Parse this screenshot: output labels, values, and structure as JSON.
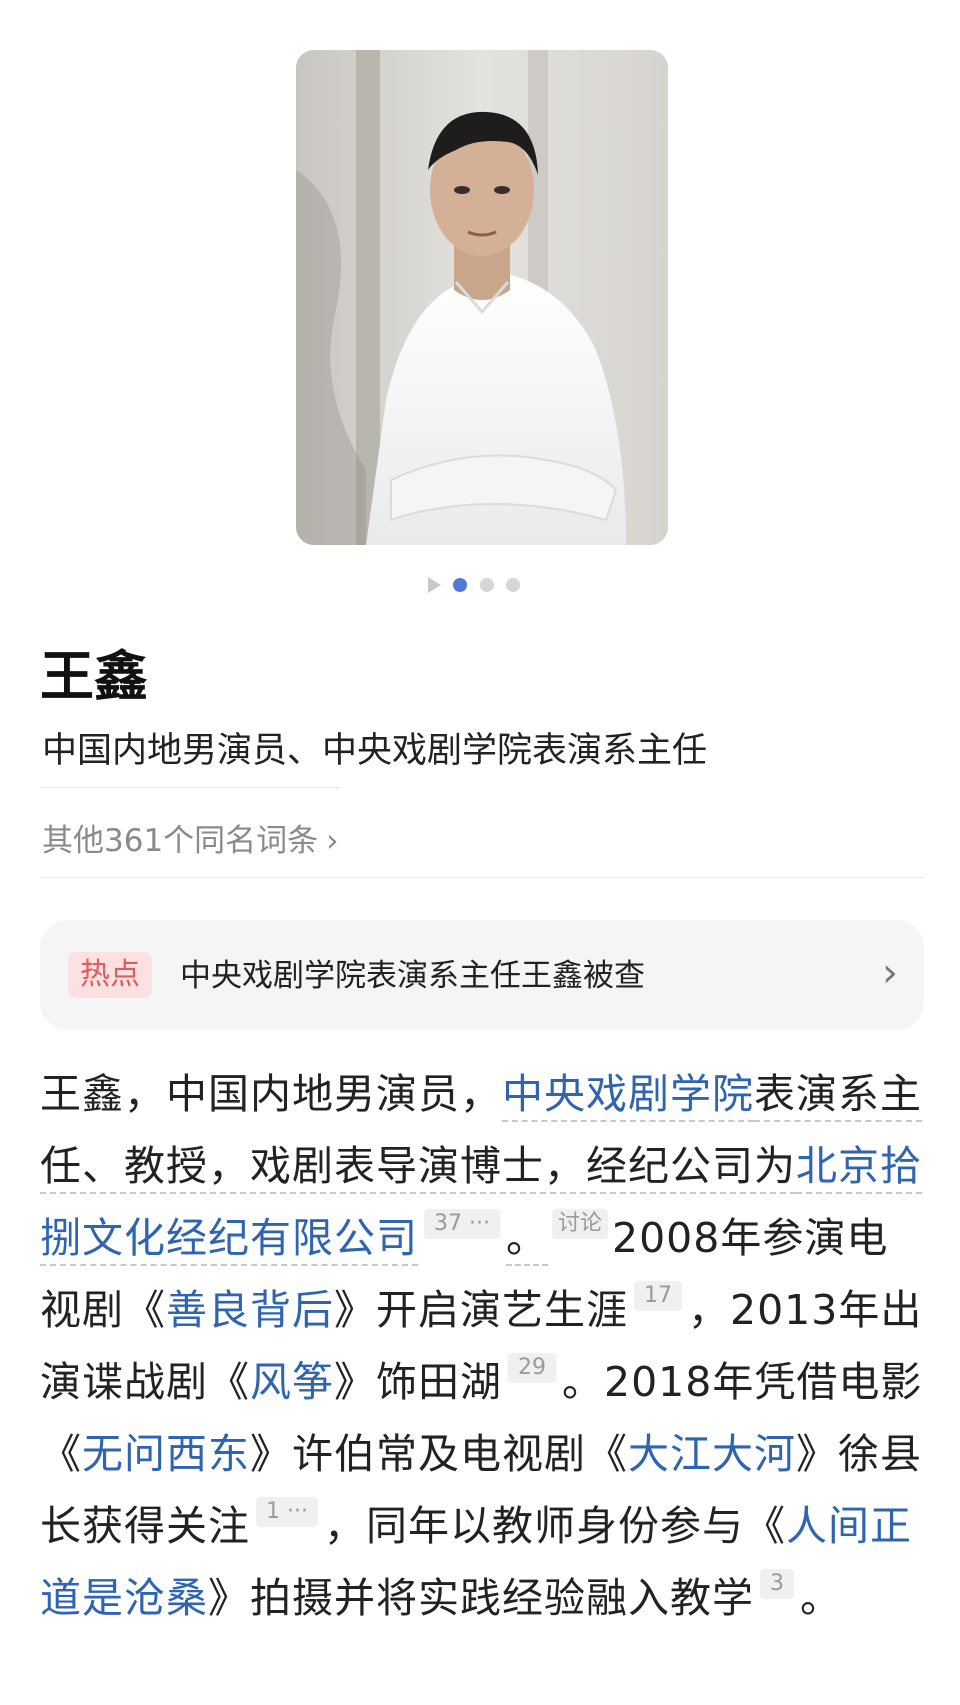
{
  "gallery": {
    "photo_alt": "王鑫",
    "dot_count": 3,
    "active_dot": 0
  },
  "entry": {
    "title": "王鑫",
    "subtitle": "中国内地男演员、中央戏剧学院表演系主任",
    "other_entries": "其他361个同名词条",
    "other_chevron": "›"
  },
  "hot": {
    "badge": "热点",
    "text": "中央戏剧学院表演系主任王鑫被查",
    "chevron": "›"
  },
  "body": {
    "p1": "王鑫，中国内地男演员，",
    "l1": "中央戏剧学院",
    "p2": "表演系主任、教授，戏剧表导演博士，经纪公司为",
    "l2": "北京拾捌文化经纪有限公司",
    "r1": "37 ···",
    "p3": "。",
    "disc": "讨论",
    "p4": "2008年参演电视剧《",
    "l3": "善良背后",
    "p5": "》开启演艺生涯",
    "r2": "17",
    "p6": "，2013年出演谍战剧《",
    "l4": "风筝",
    "p7": "》饰田湖",
    "r3": "29",
    "p8": "。2018年凭借电影《",
    "l5": "无问西东",
    "p9": "》许伯常及电视剧《",
    "l6": "大江大河",
    "p10": "》徐县长获得关注",
    "r4": "1 ···",
    "p11": "，同年以教师身份参与《",
    "l7": "人间正道是沧桑",
    "p12": "》拍摄并将实践经验融入教学",
    "r5": "3",
    "p13": "。"
  },
  "colors": {
    "link": "#2f64b0",
    "active_dot": "#4f78d8",
    "hot_badge_bg": "#fbe1e1",
    "hot_badge_text": "#e25b5b",
    "card_bg": "#f5f5f5"
  }
}
